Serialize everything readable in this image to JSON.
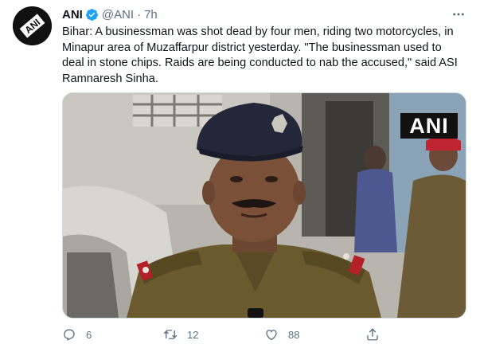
{
  "tweet": {
    "account": {
      "display_name": "ANI",
      "handle": "@ANI",
      "separator": "·",
      "time_ago": "7h",
      "verified": true,
      "avatar_logo_text": "ANI"
    },
    "text_lines": [
      "Bihar: A businessman was shot dead by four men, riding two motorcycles, in",
      "Minapur area of Muzaffarpur district yesterday. \"The businessman used to",
      "deal in stone chips. Raids are being conducted to nab the accused,\" said ASI",
      "Ramnaresh Sinha."
    ],
    "media": {
      "watermark": "ANI"
    },
    "actions": {
      "reply_count": "6",
      "retweet_count": "12",
      "like_count": "88"
    }
  },
  "colors": {
    "text": "#0f1419",
    "secondary": "#5b7083",
    "verified": "#1da1f2"
  },
  "icons": [
    "more-icon",
    "verified-icon",
    "reply-icon",
    "retweet-icon",
    "like-icon",
    "share-icon"
  ]
}
